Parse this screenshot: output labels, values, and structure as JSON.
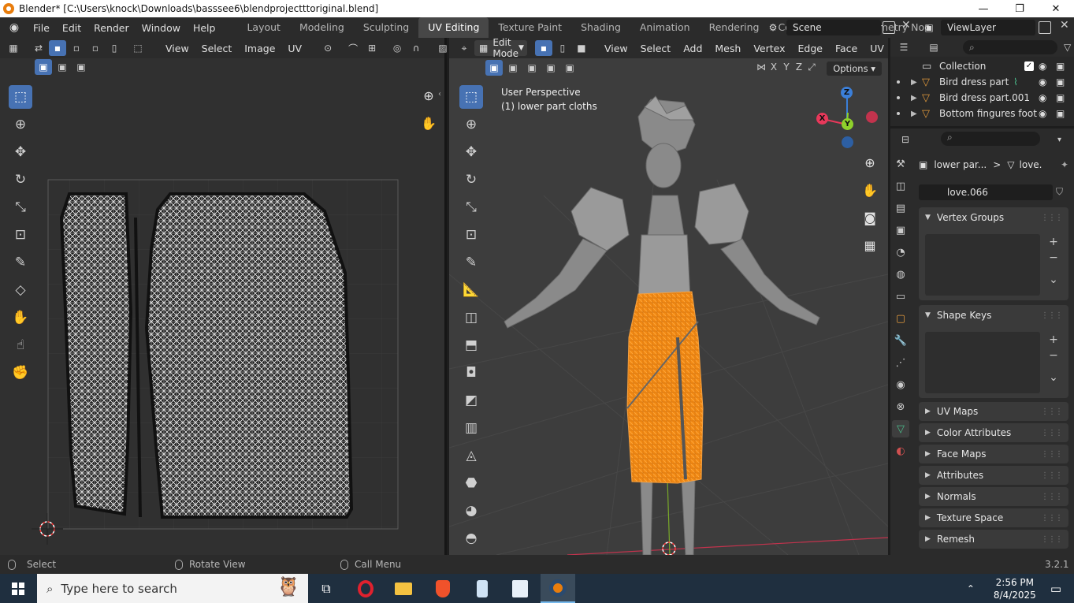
{
  "window": {
    "title": "Blender* [C:\\Users\\knock\\Downloads\\basssee6\\blendprojectttoriginal.blend]",
    "controls": [
      "—",
      "❐",
      "✕"
    ]
  },
  "menu": [
    "File",
    "Edit",
    "Render",
    "Window",
    "Help"
  ],
  "workspaces": {
    "tabs": [
      "Layout",
      "Modeling",
      "Sculpting",
      "UV Editing",
      "Texture Paint",
      "Shading",
      "Animation",
      "Rendering",
      "Compositing",
      "Geometry Noc"
    ],
    "active": "UV Editing"
  },
  "scene": {
    "name": "Scene",
    "view_layer": "ViewLayer"
  },
  "uv_editor": {
    "menus": [
      "View",
      "Select",
      "Image",
      "UV"
    ]
  },
  "viewport": {
    "mode": "Edit Mode",
    "menus": [
      "View",
      "Select",
      "Add",
      "Mesh",
      "Vertex",
      "Edge",
      "Face",
      "UV"
    ],
    "info_line1": "User Perspective",
    "info_line2": "(1) lower part cloths",
    "options": "Options",
    "axes": {
      "x": "X",
      "y": "Y",
      "z": "Z"
    },
    "mirror": [
      "X",
      "Y",
      "Z"
    ],
    "colors": {
      "selected": "#f28a14",
      "x_axis": "#e8385a",
      "y_axis": "#8fd12b",
      "z_axis": "#3b7fd9"
    }
  },
  "outliner": {
    "rows": [
      {
        "label": "Collection",
        "checked": true
      },
      {
        "label": "Bird dress part"
      },
      {
        "label": "Bird dress part.001"
      },
      {
        "label": "Bottom fingures foot"
      }
    ]
  },
  "properties": {
    "breadcrumb_object": "lower par...",
    "breadcrumb_separator": ">",
    "breadcrumb_mesh": "love.",
    "mesh_name": "love.066",
    "panels": {
      "vertex_groups": "Vertex Groups",
      "shape_keys": "Shape Keys",
      "uv_maps": "UV Maps",
      "color_attributes": "Color Attributes",
      "face_maps": "Face Maps",
      "attributes": "Attributes",
      "normals": "Normals",
      "texture_space": "Texture Space",
      "remesh": "Remesh"
    }
  },
  "statusbar": {
    "select": "Select",
    "rotate": "Rotate View",
    "call_menu": "Call Menu",
    "version": "3.2.1"
  },
  "taskbar": {
    "search_placeholder": "Type here to search",
    "time": "2:56 PM",
    "date": "8/4/2025"
  }
}
